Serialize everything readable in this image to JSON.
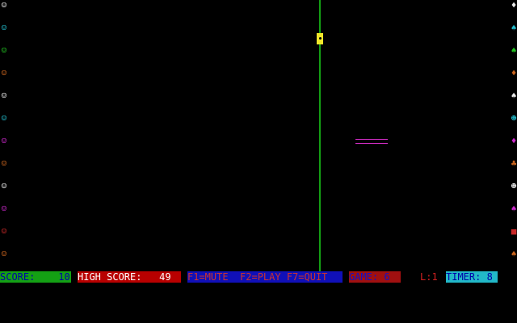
{
  "colors": {
    "background": "#000000",
    "divider": "#14a014",
    "ball": "#f0e62a",
    "paddle": "#e02fd2"
  },
  "left_column": [
    {
      "icon": "face-icon",
      "glyph": "☺",
      "color": "#e8e8e8"
    },
    {
      "icon": "face-icon",
      "glyph": "☺",
      "color": "#22b8c8"
    },
    {
      "icon": "face-icon",
      "glyph": "☺",
      "color": "#22c022"
    },
    {
      "icon": "face-icon",
      "glyph": "☺",
      "color": "#c8641e"
    },
    {
      "icon": "face-icon",
      "glyph": "☺",
      "color": "#e8e8e8"
    },
    {
      "icon": "face-icon",
      "glyph": "☺",
      "color": "#22b8c8"
    },
    {
      "icon": "face-icon",
      "glyph": "☺",
      "color": "#c828c8"
    },
    {
      "icon": "face-icon",
      "glyph": "☺",
      "color": "#c8641e"
    },
    {
      "icon": "face-icon",
      "glyph": "☺",
      "color": "#e8e8e8"
    },
    {
      "icon": "face-icon",
      "glyph": "☺",
      "color": "#c828c8"
    },
    {
      "icon": "face-icon",
      "glyph": "☺",
      "color": "#c82828"
    },
    {
      "icon": "face-icon",
      "glyph": "☺",
      "color": "#c8641e"
    }
  ],
  "right_column": [
    {
      "icon": "diamond-icon",
      "glyph": "♦",
      "color": "#e8e8e8"
    },
    {
      "icon": "spade-icon",
      "glyph": "♠",
      "color": "#22b8c8"
    },
    {
      "icon": "spade-icon",
      "glyph": "♠",
      "color": "#22c022"
    },
    {
      "icon": "diamond-icon",
      "glyph": "♦",
      "color": "#c8641e"
    },
    {
      "icon": "spade-icon",
      "glyph": "♠",
      "color": "#e8e8e8"
    },
    {
      "icon": "face-icon",
      "glyph": "☻",
      "color": "#22b8c8"
    },
    {
      "icon": "diamond-icon",
      "glyph": "♦",
      "color": "#c828c8"
    },
    {
      "icon": "club-icon",
      "glyph": "♣",
      "color": "#c8641e"
    },
    {
      "icon": "face-icon",
      "glyph": "☻",
      "color": "#e8e8e8"
    },
    {
      "icon": "spade-icon",
      "glyph": "♠",
      "color": "#c828c8"
    },
    {
      "icon": "square-icon",
      "glyph": "■",
      "color": "#c82828"
    },
    {
      "icon": "spade-icon",
      "glyph": "♠",
      "color": "#c8641e"
    }
  ],
  "status_bar": {
    "score": {
      "text": "SCORE:    10",
      "fg": "#0000a8",
      "bg": "#14a014"
    },
    "high_score": {
      "text": "HIGH SCORE:   49",
      "fg": "#ffffff",
      "bg": "#b80000"
    },
    "keys": {
      "text": "F1=MUTE  F2=PLAY F7=QUIT",
      "fg": "#c83232",
      "bg": "#1010b8"
    },
    "game": {
      "text": "GAME: 6 ",
      "fg": "#1010c8",
      "bg": "#a01010"
    },
    "level": {
      "text": "L:1",
      "fg": "#d02020",
      "bg": "#000000"
    },
    "timer": {
      "text": "TIMER: 8",
      "fg": "#0000a8",
      "bg": "#22b8c8"
    }
  }
}
